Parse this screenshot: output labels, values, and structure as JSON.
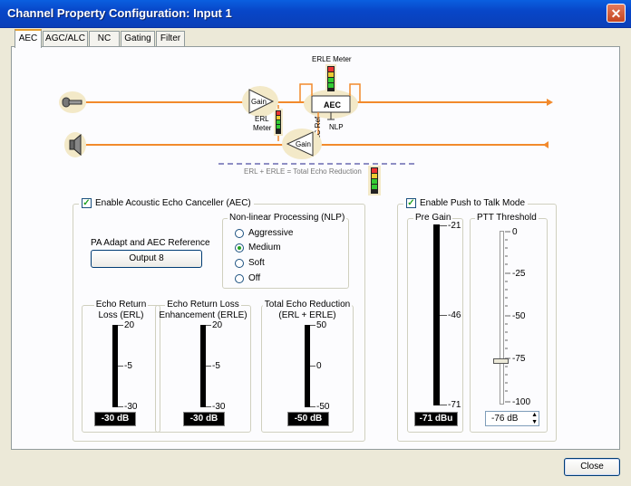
{
  "window": {
    "title": "Channel Property Configuration: Input 1",
    "close_glyph": "✕"
  },
  "tabs": [
    "AEC",
    "AGC/ALC",
    "NC",
    "Gating",
    "Filter"
  ],
  "diagram": {
    "erle_meter_label": "ERLE Meter",
    "gain_top": "Gain",
    "gain_bottom": "Gain",
    "aec_label": "AEC",
    "nlp_label": "NLP",
    "aec_ref_label": "AEC Ref",
    "erl_meter_label": "ERL Meter",
    "total_echo_label": "ERL + ERLE = Total Echo Reduction",
    "line_color": "#f28a2c"
  },
  "aec": {
    "enable_label": "Enable Acoustic Echo Canceller (AEC)",
    "enabled": true,
    "pa_label": "PA Adapt and AEC Reference",
    "pa_button": "Output 8",
    "nlp": {
      "title": "Non-linear Processing (NLP)",
      "options": [
        "Aggressive",
        "Medium",
        "Soft",
        "Off"
      ],
      "selected": "Medium"
    },
    "meters": [
      {
        "title_1": "Echo Return",
        "title_2": "Loss (ERL)",
        "ticks": [
          "20",
          "-5",
          "-30"
        ],
        "readout": "-30 dB"
      },
      {
        "title_1": "Echo Return Loss",
        "title_2": "Enhancement (ERLE)",
        "ticks": [
          "20",
          "-5",
          "-30"
        ],
        "readout": "-30 dB"
      },
      {
        "title_1": "Total Echo Reduction",
        "title_2": "(ERL + ERLE)",
        "ticks": [
          "50",
          "0",
          "-50"
        ],
        "readout": "-50 dB"
      }
    ]
  },
  "ptt": {
    "enable_label": "Enable Push to Talk Mode",
    "enabled": true,
    "pre_gain": {
      "title": "Pre Gain",
      "ticks": [
        "-21",
        "-46",
        "-71"
      ],
      "readout": "-71 dBu"
    },
    "threshold": {
      "title": "PTT Threshold",
      "ticks": [
        "0",
        "-25",
        "-50",
        "-75",
        "-100"
      ],
      "value": "-76 dB",
      "level": 0.76
    }
  },
  "footer": {
    "close_button": "Close"
  }
}
